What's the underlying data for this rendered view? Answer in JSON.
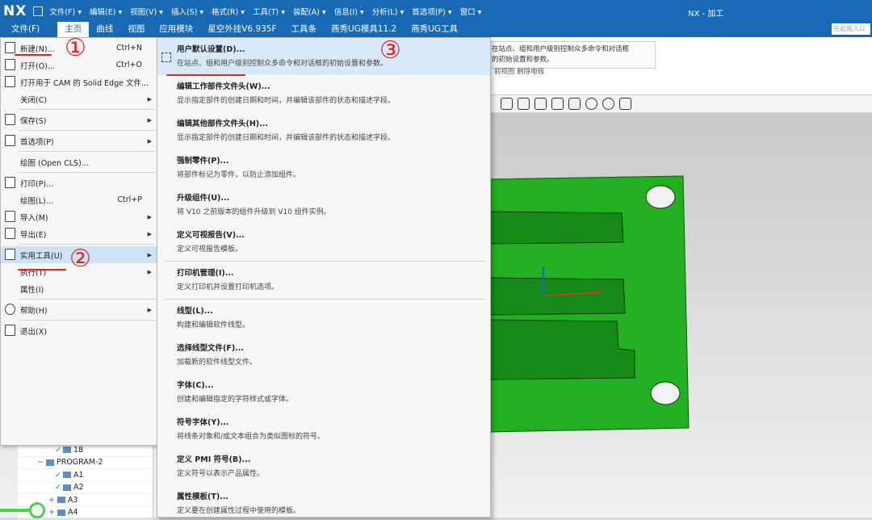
{
  "titlebar": {
    "logo": "NX",
    "menus": [
      "文件(F) ▾",
      "编辑(E) ▾",
      "视图(V) ▾",
      "插入(S) ▾",
      "格式(R) ▾",
      "工具(T) ▾",
      "装配(A) ▾",
      "信息(I) ▾",
      "分析(L) ▾",
      "首选项(P) ▾",
      "窗口 ▾"
    ],
    "window_title": "NX - 加工"
  },
  "tabs": [
    {
      "label": "文件(F)"
    },
    {
      "label": "主页"
    },
    {
      "label": "曲线"
    },
    {
      "label": "视图"
    },
    {
      "label": "应用模块"
    },
    {
      "label": "星空外挂V6.935F"
    },
    {
      "label": "工具条"
    },
    {
      "label": "燕秀UG模具11.2"
    },
    {
      "label": "燕秀UG工具"
    }
  ],
  "search": {
    "placeholder": "在此输入以"
  },
  "tooltip": {
    "line1": "在站点、组和用户级别控制众多命令和对话框",
    "line2": "的初始设置和参数。"
  },
  "ribbon_hidden_labels": "前视图  删除电极",
  "file_menu": {
    "items": [
      {
        "label": "新建(N)...",
        "shortcut": "Ctrl+N"
      },
      {
        "label": "打开(O)...",
        "shortcut": "Ctrl+O"
      },
      {
        "label": "打开用于 CAM 的 Solid Edge 文件..."
      },
      {
        "label": "关闭(C)",
        "arrow": "▶"
      },
      {
        "label": "保存(S)",
        "arrow": "▶"
      },
      {
        "label": "首选项(P)",
        "arrow": "▶"
      },
      {
        "label": "绘图 (Open CLS)..."
      },
      {
        "label": "打印(P)..."
      },
      {
        "label": "绘图(L)...",
        "shortcut": "Ctrl+P"
      },
      {
        "label": "导入(M)",
        "arrow": "▶"
      },
      {
        "label": "导出(E)",
        "arrow": "▶"
      },
      {
        "label": "实用工具(U)",
        "arrow": "▶"
      },
      {
        "label": "执行(T)",
        "arrow": "▶"
      },
      {
        "label": "属性(I)"
      },
      {
        "label": "帮助(H)",
        "arrow": "▶"
      },
      {
        "label": "退出(X)"
      }
    ]
  },
  "utility_submenu": {
    "items": [
      {
        "title": "用户默认设置(D)...",
        "desc": "在站点、组和用户级别控制众多命令和对话框的初始设置和参数。"
      },
      {
        "title": "编辑工作部件文件头(W)...",
        "desc": "显示指定部件的创建日期和时间，并编辑该部件的状态和描述字段。"
      },
      {
        "title": "编辑其他部件文件头(H)...",
        "desc": "显示指定部件的创建日期和时间，并编辑该部件的状态和描述字段。"
      },
      {
        "title": "强制零件(P)...",
        "desc": "将部件标记为零件，以防止添加组件。"
      },
      {
        "title": "升级组件(U)...",
        "desc": "将 V10 之前版本的组件升级到 V10 组件实例。"
      },
      {
        "title": "定义可视报告(V)...",
        "desc": "定义可视报告模板。"
      },
      {
        "title": "打印机管理(I)...",
        "desc": "定义打印机并设置打印机选项。"
      },
      {
        "title": "线型(L)...",
        "desc": "构建和编辑软件线型。"
      },
      {
        "title": "选择线型文件(F)...",
        "desc": "加载新的软件线型文件。"
      },
      {
        "title": "字体(C)...",
        "desc": "创建和编辑指定的字符样式或字体。"
      },
      {
        "title": "符号字体(Y)...",
        "desc": "将线条对象和/或文本组合为类似图标的符号。"
      },
      {
        "title": "定义 PMI 符号(B)...",
        "desc": "定义符号以表示产品属性。"
      },
      {
        "title": "属性模板(T)...",
        "desc": "定义要在创建属性过程中使用的模板。"
      }
    ]
  },
  "navigator": {
    "rows": [
      {
        "label": "18",
        "checked": true
      },
      {
        "label": "PROGRAM-2",
        "checked": false
      },
      {
        "label": "A1",
        "checked": true
      },
      {
        "label": "A2",
        "checked": true
      },
      {
        "label": "A3",
        "checked": false
      },
      {
        "label": "A4",
        "checked": false
      }
    ]
  },
  "annotations": {
    "one": "①",
    "two": "②",
    "three": "③"
  },
  "colors": {
    "title_blue": "#1769b3",
    "model_green": "#22b022",
    "annotation_red": "#e8221e",
    "check_green": "#1fa31f"
  }
}
